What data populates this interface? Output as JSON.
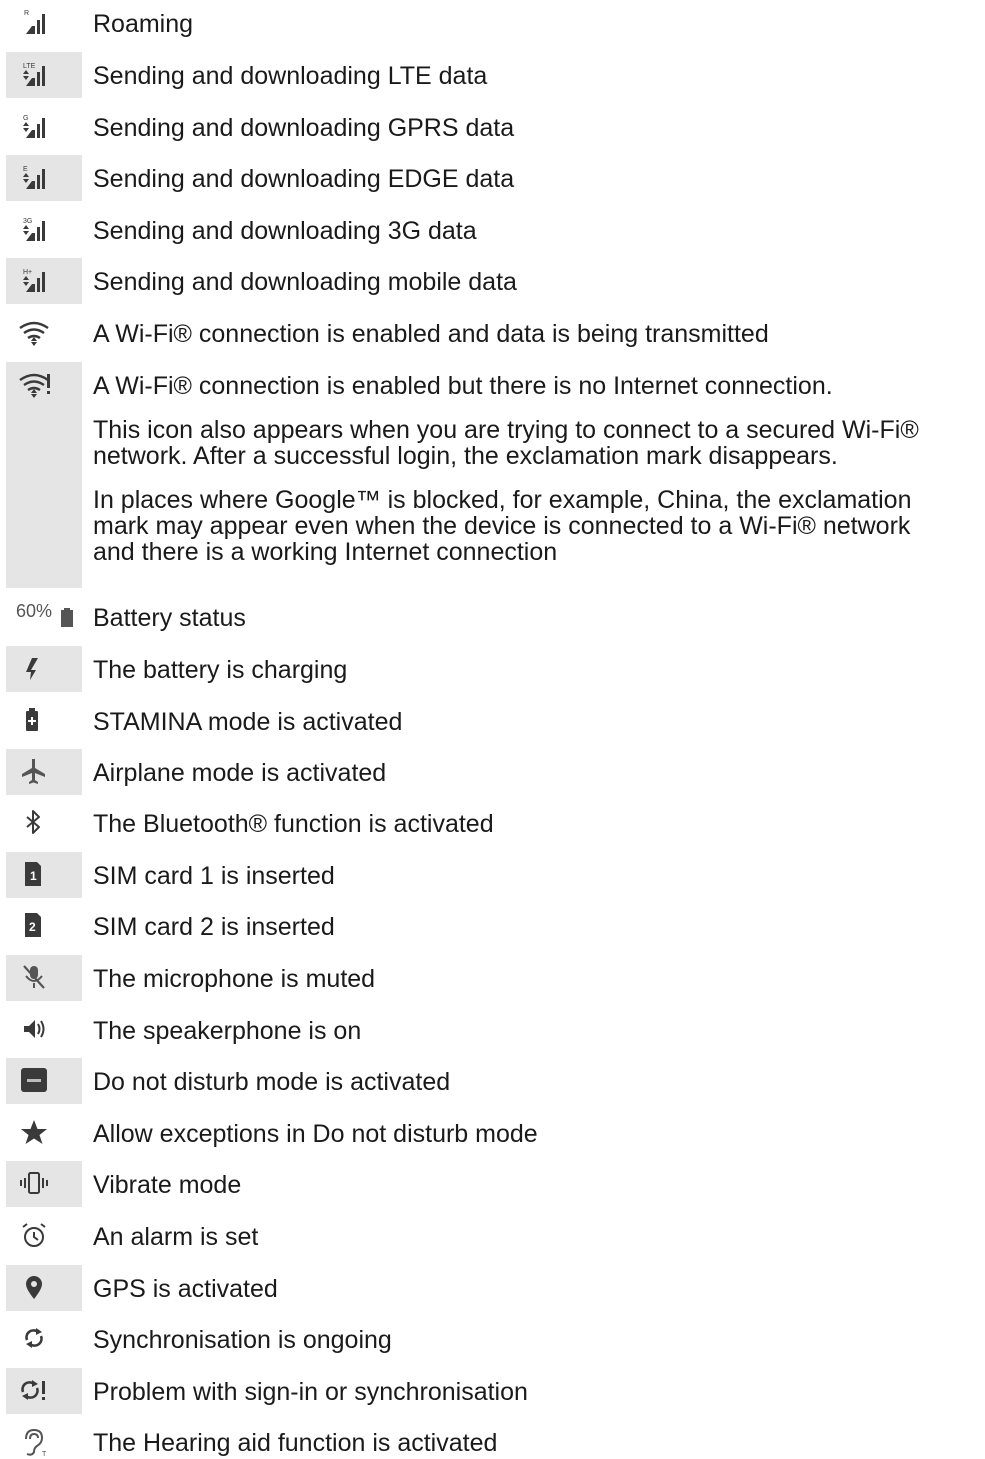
{
  "rows": [
    {
      "icon": "roaming-signal-icon",
      "lines": [
        "Roaming"
      ]
    },
    {
      "icon": "lte-data-signal-icon",
      "lines": [
        "Sending and downloading LTE data"
      ]
    },
    {
      "icon": "gprs-data-signal-icon",
      "lines": [
        "Sending and downloading GPRS data"
      ]
    },
    {
      "icon": "edge-data-signal-icon",
      "lines": [
        "Sending and downloading EDGE data"
      ]
    },
    {
      "icon": "3g-data-signal-icon",
      "lines": [
        "Sending and downloading 3G data"
      ]
    },
    {
      "icon": "mobile-data-signal-icon",
      "lines": [
        "Sending and downloading mobile data"
      ]
    },
    {
      "icon": "wifi-transmitting-icon",
      "lines": [
        "A Wi-Fi® connection is enabled and data is being transmitted"
      ]
    },
    {
      "icon": "wifi-no-internet-icon",
      "lines": [
        "A Wi-Fi® connection is enabled but there is no Internet connection.",
        "This icon also appears when you are trying to connect to a secured Wi-Fi®\nnetwork. After a successful login, the exclamation mark disappears.",
        "In places where Google™ is blocked, for example, China, the exclamation\nmark may appear even when the device is connected to a Wi-Fi® network\nand there is a working Internet connection"
      ]
    },
    {
      "icon": "battery-status-icon",
      "icon_text": "60%",
      "lines": [
        "Battery status"
      ]
    },
    {
      "icon": "battery-charging-icon",
      "lines": [
        "The battery is charging"
      ]
    },
    {
      "icon": "stamina-mode-icon",
      "lines": [
        "STAMINA mode is activated"
      ]
    },
    {
      "icon": "airplane-mode-icon",
      "lines": [
        "Airplane mode is activated"
      ]
    },
    {
      "icon": "bluetooth-icon",
      "lines": [
        "The Bluetooth® function is activated"
      ]
    },
    {
      "icon": "sim-card-1-icon",
      "lines": [
        "SIM card 1 is inserted"
      ]
    },
    {
      "icon": "sim-card-2-icon",
      "lines": [
        "SIM card 2 is inserted"
      ]
    },
    {
      "icon": "microphone-muted-icon",
      "lines": [
        "The microphone is muted"
      ]
    },
    {
      "icon": "speakerphone-icon",
      "lines": [
        "The speakerphone is on"
      ]
    },
    {
      "icon": "do-not-disturb-icon",
      "lines": [
        "Do not disturb mode is activated"
      ]
    },
    {
      "icon": "star-icon",
      "lines": [
        "Allow exceptions in Do not disturb mode"
      ]
    },
    {
      "icon": "vibrate-mode-icon",
      "lines": [
        "Vibrate mode"
      ]
    },
    {
      "icon": "alarm-clock-icon",
      "lines": [
        "An alarm is set"
      ]
    },
    {
      "icon": "gps-location-icon",
      "lines": [
        "GPS is activated"
      ]
    },
    {
      "icon": "sync-icon",
      "lines": [
        "Synchronisation is ongoing"
      ]
    },
    {
      "icon": "sync-problem-icon",
      "lines": [
        "Problem with sign-in or synchronisation"
      ]
    },
    {
      "icon": "hearing-aid-icon",
      "lines": [
        "The Hearing aid function is activated"
      ]
    }
  ]
}
